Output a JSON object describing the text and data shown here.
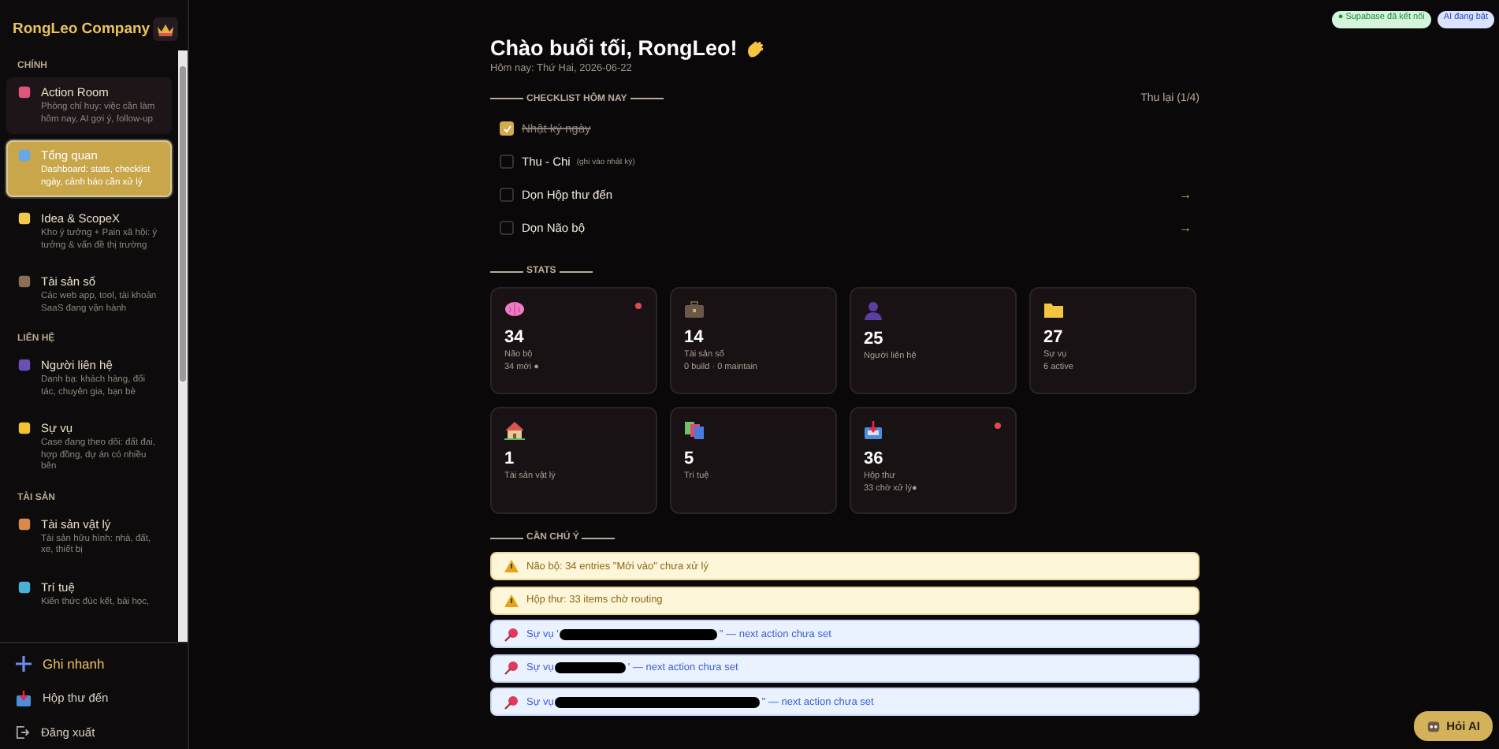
{
  "sidebar": {
    "brand": "RongLeo Company",
    "sections": [
      {
        "title": "CHÍNH",
        "items": [
          {
            "label": "Action Room",
            "description": "Phòng chỉ huy: việc cần làm hôm nay, AI gợi ý, follow-up",
            "selected": false,
            "highlighted": true
          },
          {
            "label": "Tổng quan",
            "description": "Dashboard: stats, checklist ngày, cảnh báo cần xử lý",
            "selected": true,
            "highlighted": false
          },
          {
            "label": "Idea & ScopeX",
            "description": "Kho ý tưởng + Pain xã hội: ý tưởng & vấn đề thị trường",
            "selected": false,
            "highlighted": false
          },
          {
            "label": "Tài sản số",
            "description": "Các web app, tool, tài khoản SaaS đang vận hành",
            "selected": false,
            "highlighted": false
          }
        ]
      },
      {
        "title": "LIÊN HỆ",
        "items": [
          {
            "label": "Người liên hệ",
            "description": "Danh bạ: khách hàng, đối tác, chuyên gia, bạn bè",
            "selected": false,
            "highlighted": false
          },
          {
            "label": "Sự vụ",
            "description": "Case đang theo dõi: đất đai, hợp đồng, dự án có nhiều bên",
            "selected": false,
            "highlighted": false
          }
        ]
      },
      {
        "title": "TÀI SẢN",
        "items": [
          {
            "label": "Tài sản vật lý",
            "description": "Tài sản hữu hình: nhà, đất, xe, thiết bị",
            "selected": false,
            "highlighted": false
          },
          {
            "label": "Trí tuệ",
            "description": "Kiến thức đúc kết, bài học,",
            "selected": false,
            "highlighted": false
          }
        ]
      }
    ],
    "footer": [
      {
        "kind": "quick",
        "label": "Ghi nhanh"
      },
      {
        "kind": "inbox",
        "label": "Hộp thư đến"
      },
      {
        "kind": "logout",
        "label": "Đăng xuất"
      }
    ]
  },
  "status_badges": [
    {
      "label": "● Supabase đã kết nối",
      "kind": "ok"
    },
    {
      "label": "AI đang bật",
      "kind": "ai"
    }
  ],
  "greeting": {
    "title": "Chào buổi tối, RongLeo!",
    "date": "Hôm nay: Thứ Hai, 2026-06-22"
  },
  "checklist": {
    "title": "CHECKLIST HÔM NAY",
    "collapse": "Thu lại (1/4)",
    "items": [
      {
        "label": "Nhật ký ngày",
        "checked": true
      },
      {
        "label": "Thu - Chi",
        "note": "(ghi vào nhật ký)",
        "checked": false
      },
      {
        "label": "Dọn Hộp thư đến",
        "arrow": "→",
        "checked": false
      },
      {
        "label": "Dọn Não bộ",
        "arrow": "→",
        "checked": false
      }
    ]
  },
  "stats": {
    "title": "STATS",
    "cards": [
      {
        "value": "34",
        "label": "Não bộ",
        "detail": "34 mới ●",
        "alert": true
      },
      {
        "value": "14",
        "label": "Tài sản số",
        "detail": "0 build · 0 maintain",
        "alert": false
      },
      {
        "value": "25",
        "label": "Người liên hệ",
        "alert": false
      },
      {
        "value": "27",
        "label": "Sự vụ",
        "detail": "6 active",
        "alert": false
      },
      {
        "value": "1",
        "label": "Tài sản vật lý",
        "alert": false
      },
      {
        "value": "5",
        "label": "Trí tuệ",
        "alert": false
      },
      {
        "value": "36",
        "label": "Hộp thư",
        "detail": "33 chờ xử lý●",
        "alert": true
      }
    ]
  },
  "attention": {
    "title": "CẦN CHÚ Ý",
    "items": [
      {
        "kind": "warning",
        "text": "Não bộ: 34 entries \"Mới vào\" chưa xử lý"
      },
      {
        "kind": "warning",
        "text": "Hộp thư: 33 items chờ routing"
      },
      {
        "kind": "pin",
        "text": "Sự vụ '",
        "after": "\" — next action chưa set"
      },
      {
        "kind": "pin",
        "text": "Sự vụ",
        "after": "' — next action chưa set"
      },
      {
        "kind": "pin",
        "text": "Sự vụ",
        "after": "\" — next action chưa set"
      }
    ]
  },
  "ask_ai": {
    "label": "Hỏi AI"
  }
}
